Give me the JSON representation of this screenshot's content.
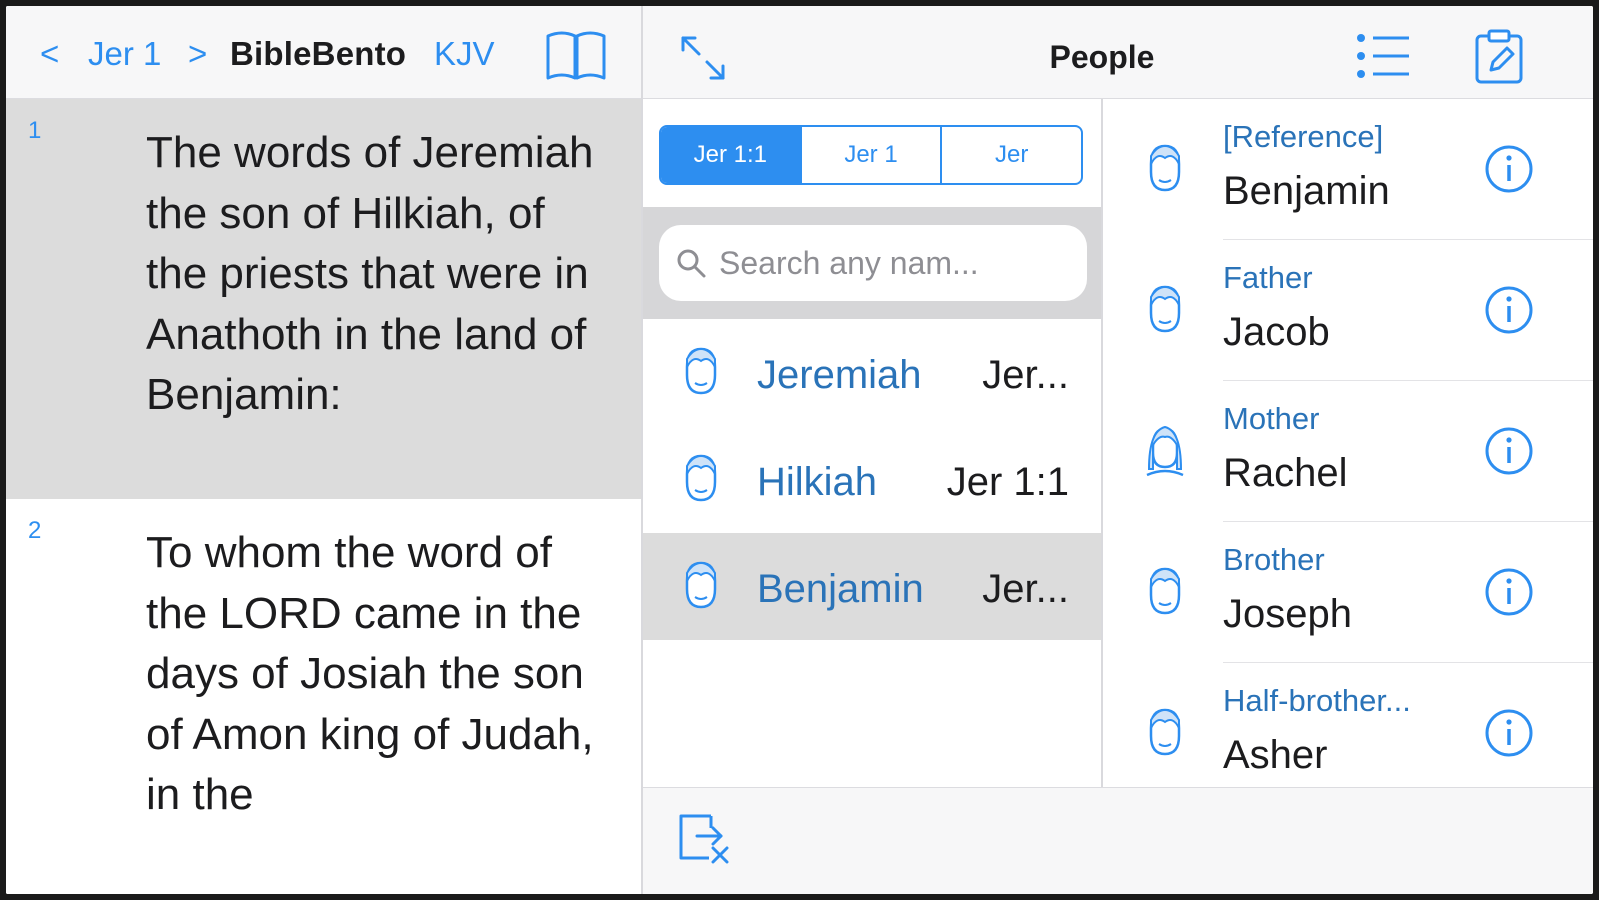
{
  "nav": {
    "prev": "<",
    "chapter": "Jer 1",
    "next": ">",
    "app_name": "BibleBento",
    "version": "KJV"
  },
  "verses": [
    {
      "num": "1",
      "text": "The words of Jeremiah the son of Hilkiah, of the priests that were in Anathoth in the land of Benjamin:"
    },
    {
      "num": "2",
      "text": "To whom the word of the LORD came in the days of Josiah the son of Amon king of Judah, in the"
    }
  ],
  "panel": {
    "title": "People"
  },
  "scope_tabs": [
    "Jer 1:1",
    "Jer 1",
    "Jer"
  ],
  "search": {
    "placeholder": "Search any nam..."
  },
  "people": [
    {
      "name": "Jeremiah",
      "ref": "Jer..."
    },
    {
      "name": "Hilkiah",
      "ref": "Jer 1:1"
    },
    {
      "name": "Benjamin",
      "ref": "Jer..."
    }
  ],
  "relations": [
    {
      "label": "[Reference]",
      "name": "Benjamin",
      "icon": "male-person-icon"
    },
    {
      "label": "Father",
      "name": "Jacob",
      "icon": "male-person-icon"
    },
    {
      "label": "Mother",
      "name": "Rachel",
      "icon": "female-person-icon"
    },
    {
      "label": "Brother",
      "name": "Joseph",
      "icon": "male-person-icon"
    },
    {
      "label": "Half-brother...",
      "name": "Asher",
      "icon": "male-person-icon"
    }
  ],
  "colors": {
    "accent": "#2d8ef0",
    "name_blue": "#2a73b8",
    "highlight": "#dcdcdc"
  }
}
